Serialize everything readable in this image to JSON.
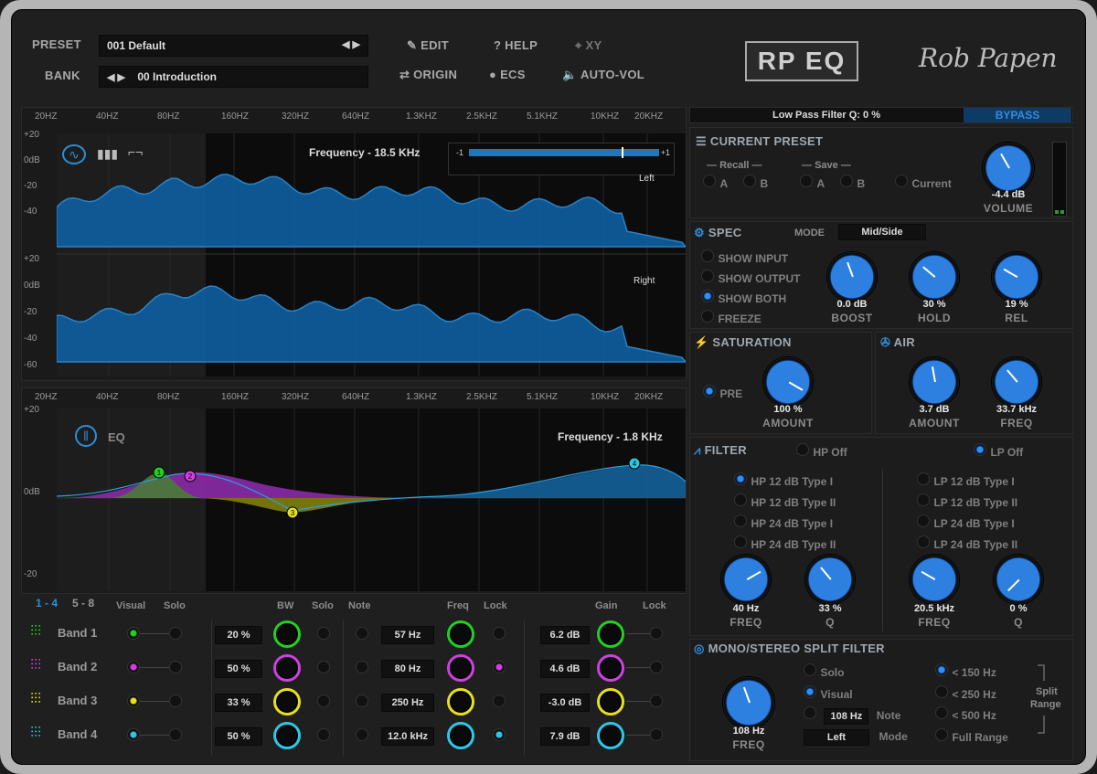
{
  "header": {
    "preset_label": "PRESET",
    "preset_value": "001 Default",
    "bank_label": "BANK",
    "bank_value": "00 Introduction",
    "edit": "EDIT",
    "help": "HELP",
    "xy": "XY",
    "origin": "ORIGIN",
    "ecs": "ECS",
    "auto_vol": "AUTO-VOL",
    "logo": "RP EQ",
    "brand": "Rob Papen"
  },
  "spectrum": {
    "freq_ticks": [
      "20HZ",
      "40HZ",
      "80HZ",
      "160HZ",
      "320HZ",
      "640HZ",
      "1.3KHZ",
      "2.5KHZ",
      "5.1KHZ",
      "10KHZ",
      "20KHZ"
    ],
    "db_top": [
      "+20",
      "0dB",
      "-20",
      "-40"
    ],
    "db_bottom": [
      "+20",
      "0dB",
      "-20",
      "-40",
      "-60"
    ],
    "frequency_readout": "Frequency - 18.5 KHz",
    "balance_min": "-1",
    "balance_max": "+1",
    "left": "Left",
    "right": "Right"
  },
  "eq": {
    "freq_ticks": [
      "20HZ",
      "40HZ",
      "80HZ",
      "160HZ",
      "320HZ",
      "640HZ",
      "1.3KHZ",
      "2.5KHZ",
      "5.1KHZ",
      "10KHZ",
      "20KHZ"
    ],
    "db": [
      "+20",
      "0dB",
      "-20"
    ],
    "title": "EQ",
    "frequency_readout": "Frequency - 1.8 KHz",
    "page_a": "1 - 4",
    "page_b": "5 - 8",
    "cols": {
      "visual": "Visual",
      "solo": "Solo",
      "bw": "BW",
      "solo2": "Solo",
      "note": "Note",
      "freq": "Freq",
      "lock": "Lock",
      "gain": "Gain",
      "lock2": "Lock"
    },
    "bands": [
      {
        "name": "Band 1",
        "color": "#22d022",
        "bw": "20 %",
        "freq": "57 Hz",
        "gain": "6.2 dB",
        "node": "1"
      },
      {
        "name": "Band 2",
        "color": "#d040e0",
        "bw": "50 %",
        "freq": "80 Hz",
        "gain": "4.6 dB",
        "node": "2"
      },
      {
        "name": "Band 3",
        "color": "#e6df20",
        "bw": "33 %",
        "freq": "250 Hz",
        "gain": "-3.0 dB",
        "node": "3"
      },
      {
        "name": "Band 4",
        "color": "#2cc8e8",
        "bw": "50 %",
        "freq": "12.0 kHz",
        "gain": "7.9 dB",
        "node": "4"
      }
    ]
  },
  "right": {
    "lpf_text": "Low Pass Filter Q: 0 %",
    "bypass": "BYPASS",
    "current_preset": "CURRENT PRESET",
    "recall": "Recall",
    "save": "Save",
    "a": "A",
    "b": "B",
    "current": "Current",
    "volume_value": "-4.4 dB",
    "volume_label": "VOLUME",
    "spec": "SPEC",
    "mode_label": "MODE",
    "mode_value": "Mid/Side",
    "show_input": "SHOW INPUT",
    "show_output": "SHOW OUTPUT",
    "show_both": "SHOW BOTH",
    "freeze": "FREEZE",
    "boost_value": "0.0 dB",
    "boost": "BOOST",
    "hold_value": "30 %",
    "hold": "HOLD",
    "rel_value": "19 %",
    "rel": "REL",
    "saturation": "SATURATION",
    "pre": "PRE",
    "sat_amount_value": "100 %",
    "sat_amount": "AMOUNT",
    "air": "AIR",
    "air_amount_value": "3.7 dB",
    "air_amount": "AMOUNT",
    "air_freq_value": "33.7 kHz",
    "air_freq": "FREQ",
    "filter": "FILTER",
    "hp_off": "HP Off",
    "lp_off": "LP Off",
    "hp_types": [
      "HP 12 dB Type I",
      "HP 12 dB Type II",
      "HP 24 dB Type I",
      "HP 24 dB Type II"
    ],
    "lp_types": [
      "LP 12 dB Type I",
      "LP 12 dB Type II",
      "LP 24 dB Type I",
      "LP 24 dB Type II"
    ],
    "hp_freq_value": "40 Hz",
    "hp_freq": "FREQ",
    "hp_q_value": "33 %",
    "hp_q": "Q",
    "lp_freq_value": "20.5 kHz",
    "lp_freq": "FREQ",
    "lp_q_value": "0 %",
    "lp_q": "Q",
    "ms_split": "MONO/STEREO SPLIT FILTER",
    "solo": "Solo",
    "visual": "Visual",
    "note_val": "108 Hz",
    "note": "Note",
    "mode_val": "Left",
    "mode": "Mode",
    "r150": "< 150 Hz",
    "r250": "< 250 Hz",
    "r500": "< 500 Hz",
    "full": "Full Range",
    "split": "Split",
    "range": "Range",
    "split_freq_value": "108 Hz",
    "split_freq": "FREQ"
  }
}
